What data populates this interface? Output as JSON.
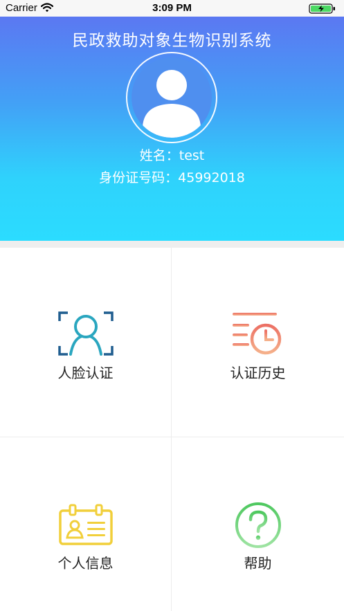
{
  "status_bar": {
    "carrier": "Carrier",
    "time": "3:09 PM",
    "wifi_icon": "wifi-icon",
    "battery_icon": "battery-charging-icon"
  },
  "header": {
    "title": "民政救助对象生物识别系统",
    "avatar_icon": "user-avatar-icon",
    "name_label": "姓名：",
    "name_value": "test",
    "id_label": "身份证号码：",
    "id_value": "45992018",
    "gradient_top": "#5b78f2",
    "gradient_bottom": "#2bdcff"
  },
  "menu": {
    "items": [
      {
        "label": "人脸认证",
        "icon": "face-scan-icon",
        "color": "#2a9fb8"
      },
      {
        "label": "认证历史",
        "icon": "history-clock-icon",
        "color": "#ee7f6d"
      },
      {
        "label": "个人信息",
        "icon": "id-card-icon",
        "color": "#f1cf3a"
      },
      {
        "label": "帮助",
        "icon": "help-question-icon",
        "color": "#5ccf6a"
      }
    ]
  }
}
